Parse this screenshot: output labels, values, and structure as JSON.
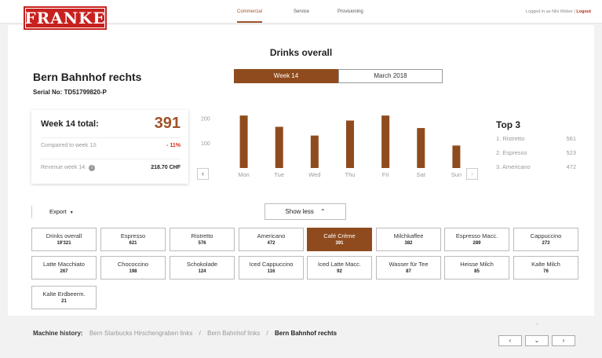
{
  "nav": {
    "commercial": "Commercial",
    "service": "Service",
    "provisioning": "Provisioning",
    "logged_in": "Logged in as Nils Weber",
    "logout": "Logout"
  },
  "brand": {
    "logo_text": "FRANKE",
    "brand_color": "#c7211f",
    "accent_color": "#8f4b1d"
  },
  "page": {
    "title": "Drinks overall",
    "machine_name": "Bern Bahnhof rechts",
    "serial": "Serial No: TD51799820-P"
  },
  "period_toggle": {
    "week": "Week 14",
    "month": "March 2018",
    "selected": "week"
  },
  "summary": {
    "total_label": "Week 14 total:",
    "total_value": "391",
    "compare_label": "Compaired to week 13:",
    "compare_value": "- 11%",
    "revenue_label": "Revenue week 14:",
    "revenue_value": "218.70 CHF"
  },
  "chart_data": {
    "type": "bar",
    "categories": [
      "Mon",
      "Tue",
      "Wed",
      "Thu",
      "Fri",
      "Sat",
      "Sun"
    ],
    "values": [
      210,
      165,
      130,
      190,
      210,
      160,
      90
    ],
    "ylim": [
      0,
      220
    ],
    "yticks": [
      "100",
      "200"
    ],
    "bar_color": "#8f4b1d",
    "grid": false
  },
  "top3": {
    "title": "Top 3",
    "items": [
      {
        "name": "1. Ristretto",
        "value": "561"
      },
      {
        "name": "2. Espresso",
        "value": "523"
      },
      {
        "name": "3. Americano",
        "value": "472"
      }
    ]
  },
  "controls": {
    "export": "Export",
    "show_less": "Show less"
  },
  "drinks": [
    {
      "name": "Drinks overall",
      "count": "19'321"
    },
    {
      "name": "Espresso",
      "count": "621"
    },
    {
      "name": "Ristretto",
      "count": "576"
    },
    {
      "name": "Americano",
      "count": "472"
    },
    {
      "name": "Café Crème",
      "count": "391",
      "active": true
    },
    {
      "name": "Milchkaffee",
      "count": "382"
    },
    {
      "name": "Espresso Macc.",
      "count": "289"
    },
    {
      "name": "Cappuccino",
      "count": "273"
    },
    {
      "name": "Latte Macchiato",
      "count": "267"
    },
    {
      "name": "Chococcino",
      "count": "198"
    },
    {
      "name": "Schokolade",
      "count": "124"
    },
    {
      "name": "Iced Cappuccino",
      "count": "116"
    },
    {
      "name": "Iced Latte Macc.",
      "count": "92"
    },
    {
      "name": "Wasser für Tee",
      "count": "87"
    },
    {
      "name": "Heisse Milch",
      "count": "85"
    },
    {
      "name": "Kalte Milch",
      "count": "76"
    },
    {
      "name": "Kalte Erdbeerm.",
      "count": "21"
    }
  ],
  "history": {
    "label": "Machine history:",
    "items": [
      "Bern Starbucks Hirschengraben links",
      "Bern Bahnhof links"
    ],
    "current": "Bern Bahnhof rechts"
  }
}
